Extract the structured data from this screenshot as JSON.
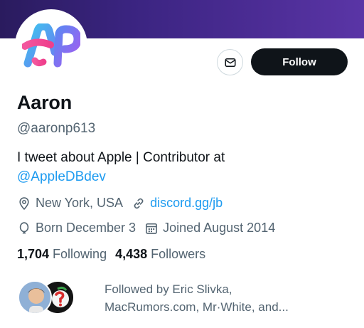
{
  "profile": {
    "name": "Aaron",
    "handle": "@aaronp613",
    "bio_text": "I tweet about Apple | Contributor at",
    "bio_mention": "@AppleDBdev",
    "location": "New York, USA",
    "website": "discord.gg/jb",
    "born": "Born December 3",
    "joined": "Joined August 2014"
  },
  "actions": {
    "follow_label": "Follow"
  },
  "stats": {
    "following_count": "1,704",
    "following_label": "Following",
    "followers_count": "4,438",
    "followers_label": "Followers"
  },
  "followed_by": {
    "line1": "Followed by Eric Slivka,",
    "line2": "MacRumors.com, Mr·White, and..."
  },
  "colors": {
    "accent": "#1d9bf0",
    "text": "#0f1419",
    "muted": "#536471",
    "banner": "#3a2480"
  },
  "icons": [
    "mail-icon",
    "location-icon",
    "link-icon",
    "balloon-icon",
    "calendar-icon"
  ]
}
